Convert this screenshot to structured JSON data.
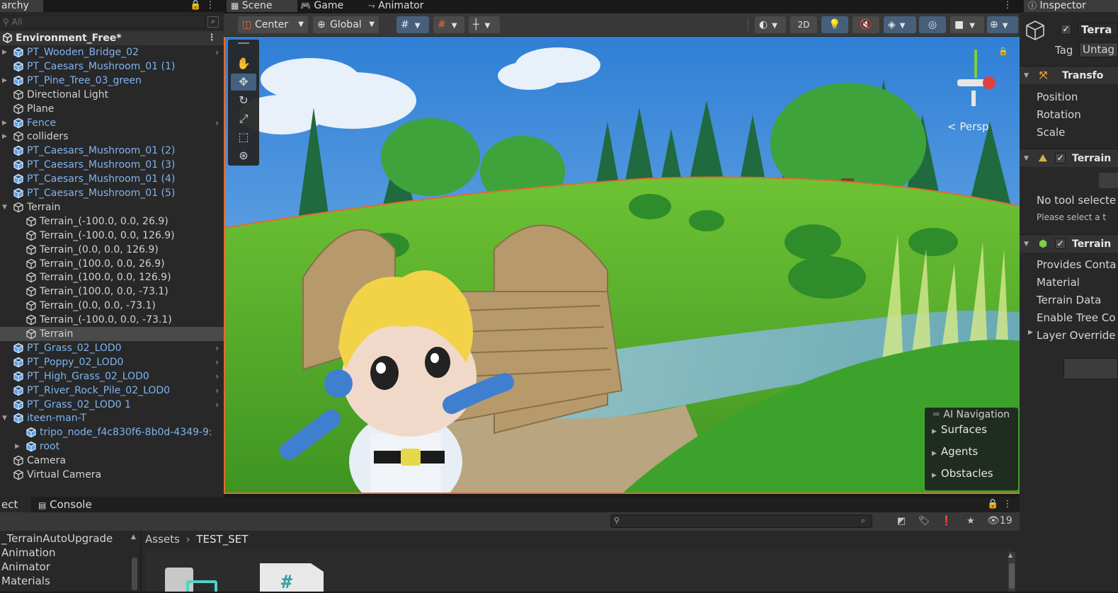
{
  "hierarchy": {
    "tab_label": "archy",
    "search_placeholder": "All",
    "scene_name": "Environment_Free*",
    "items": [
      {
        "label": "PT_Wooden_Bridge_02",
        "prefab": true,
        "expandable": true,
        "chevron": true,
        "indent": 0
      },
      {
        "label": "PT_Caesars_Mushroom_01 (1)",
        "prefab": true,
        "expandable": false,
        "chevron": false,
        "indent": 0
      },
      {
        "label": "PT_Pine_Tree_03_green",
        "prefab": true,
        "expandable": true,
        "chevron": false,
        "indent": 0
      },
      {
        "label": "Directional Light",
        "prefab": false,
        "expandable": false,
        "chevron": false,
        "indent": 0
      },
      {
        "label": "Plane",
        "prefab": false,
        "expandable": false,
        "chevron": false,
        "indent": 0
      },
      {
        "label": "Fence",
        "prefab": true,
        "expandable": true,
        "chevron": true,
        "indent": 0
      },
      {
        "label": "colliders",
        "prefab": false,
        "expandable": true,
        "chevron": false,
        "indent": 0
      },
      {
        "label": "PT_Caesars_Mushroom_01 (2)",
        "prefab": true,
        "expandable": false,
        "chevron": false,
        "indent": 0
      },
      {
        "label": "PT_Caesars_Mushroom_01 (3)",
        "prefab": true,
        "expandable": false,
        "chevron": false,
        "indent": 0
      },
      {
        "label": "PT_Caesars_Mushroom_01 (4)",
        "prefab": true,
        "expandable": false,
        "chevron": false,
        "indent": 0
      },
      {
        "label": "PT_Caesars_Mushroom_01 (5)",
        "prefab": true,
        "expandable": false,
        "chevron": false,
        "indent": 0
      },
      {
        "label": "Terrain",
        "prefab": false,
        "expandable": true,
        "expanded": true,
        "chevron": false,
        "indent": 0
      },
      {
        "label": "Terrain_(-100.0, 0.0, 26.9)",
        "prefab": false,
        "expandable": false,
        "chevron": false,
        "indent": 1
      },
      {
        "label": "Terrain_(-100.0, 0.0, 126.9)",
        "prefab": false,
        "expandable": false,
        "chevron": false,
        "indent": 1
      },
      {
        "label": "Terrain_(0.0, 0.0, 126.9)",
        "prefab": false,
        "expandable": false,
        "chevron": false,
        "indent": 1
      },
      {
        "label": "Terrain_(100.0, 0.0, 26.9)",
        "prefab": false,
        "expandable": false,
        "chevron": false,
        "indent": 1
      },
      {
        "label": "Terrain_(100.0, 0.0, 126.9)",
        "prefab": false,
        "expandable": false,
        "chevron": false,
        "indent": 1
      },
      {
        "label": "Terrain_(100.0, 0.0, -73.1)",
        "prefab": false,
        "expandable": false,
        "chevron": false,
        "indent": 1
      },
      {
        "label": "Terrain_(0.0, 0.0, -73.1)",
        "prefab": false,
        "expandable": false,
        "chevron": false,
        "indent": 1
      },
      {
        "label": "Terrain_(-100.0, 0.0, -73.1)",
        "prefab": false,
        "expandable": false,
        "chevron": false,
        "indent": 1
      },
      {
        "label": "Terrain",
        "prefab": false,
        "expandable": false,
        "chevron": false,
        "indent": 1,
        "selected": true
      },
      {
        "label": "PT_Grass_02_LOD0",
        "prefab": true,
        "expandable": false,
        "chevron": true,
        "indent": 0
      },
      {
        "label": "PT_Poppy_02_LOD0",
        "prefab": true,
        "expandable": false,
        "chevron": true,
        "indent": 0
      },
      {
        "label": "PT_High_Grass_02_LOD0",
        "prefab": true,
        "expandable": false,
        "chevron": true,
        "indent": 0
      },
      {
        "label": "PT_River_Rock_Pile_02_LOD0",
        "prefab": true,
        "expandable": false,
        "chevron": true,
        "indent": 0
      },
      {
        "label": "PT_Grass_02_LOD0 1",
        "prefab": true,
        "expandable": false,
        "chevron": true,
        "indent": 0
      },
      {
        "label": "iteen-man-T",
        "prefab": true,
        "expandable": true,
        "expanded": true,
        "chevron": false,
        "indent": 0
      },
      {
        "label": "tripo_node_f4c830f6-8b0d-4349-9:",
        "prefab": true,
        "expandable": false,
        "chevron": false,
        "indent": 1
      },
      {
        "label": "root",
        "prefab": true,
        "expandable": true,
        "chevron": false,
        "indent": 1
      },
      {
        "label": "Camera",
        "prefab": false,
        "expandable": false,
        "chevron": false,
        "indent": 0
      },
      {
        "label": "Virtual Camera",
        "prefab": false,
        "expandable": false,
        "chevron": false,
        "indent": 0
      }
    ]
  },
  "scene": {
    "tabs": [
      {
        "label": "Scene",
        "icon": "grid-icon"
      },
      {
        "label": "Game",
        "icon": "gamepad-icon"
      },
      {
        "label": "Animator",
        "icon": "animator-icon"
      }
    ],
    "pivot_label": "Center",
    "space_label": "Global",
    "mode_2d_label": "2D",
    "persp_label": "< Persp",
    "ai_nav": {
      "header": "AI Navigation",
      "items": [
        "Surfaces",
        "Agents",
        "Obstacles"
      ]
    }
  },
  "inspector": {
    "tab_label": "Inspector",
    "object_name": "Terra",
    "tag_label": "Tag",
    "tag_value": "Untag",
    "transform": {
      "title": "Transfo",
      "rows": [
        "Position",
        "Rotation",
        "Scale"
      ]
    },
    "terrain_comp": {
      "title": "Terrain",
      "no_tool": "No tool selecte",
      "hint": "Please select a t"
    },
    "collider_comp": {
      "title": "Terrain",
      "rows": [
        "Provides Conta",
        "Material",
        "Terrain Data",
        "Enable Tree Co",
        "Layer Override"
      ]
    }
  },
  "project": {
    "tabs": [
      "ect",
      "Console"
    ],
    "folders": [
      "_TerrainAutoUpgrade",
      "Animation",
      "Animator",
      "Materials"
    ],
    "breadcrumb_root": "Assets",
    "breadcrumb_current": "TEST_SET",
    "visible_count": "19"
  },
  "colors": {
    "accent_blue": "#46607c",
    "prefab_blue": "#7fb3f0",
    "selection_orange": "#e36b2f"
  }
}
